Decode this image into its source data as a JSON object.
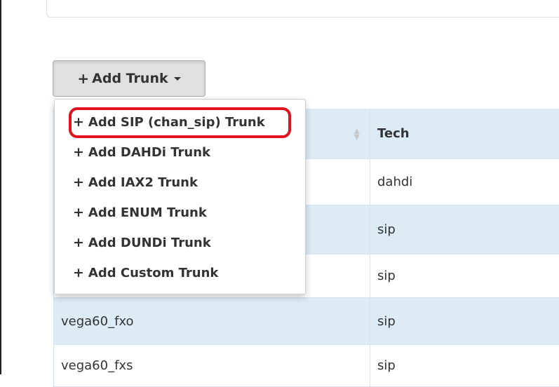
{
  "toolbar": {
    "add_trunk_label": "Add Trunk",
    "plus_glyph": "+"
  },
  "dropdown": {
    "items": [
      {
        "label": "Add SIP (chan_sip) Trunk",
        "highlighted": true
      },
      {
        "label": "Add DAHDi Trunk"
      },
      {
        "label": "Add IAX2 Trunk"
      },
      {
        "label": "Add ENUM Trunk"
      },
      {
        "label": "Add DUNDi Trunk"
      },
      {
        "label": "Add Custom Trunk"
      }
    ],
    "highlight_color": "#e0131f"
  },
  "table": {
    "columns": [
      "",
      "Tech"
    ],
    "rows": [
      {
        "name": "",
        "tech": "dahdi"
      },
      {
        "name": "",
        "tech": "sip"
      },
      {
        "name": "",
        "tech": "sip"
      },
      {
        "name": "vega60_fxo",
        "tech": "sip"
      },
      {
        "name": "vega60_fxs",
        "tech": "sip"
      }
    ],
    "stripe_color": "#ddebf7"
  },
  "icons": {
    "plus": "plus-icon",
    "caret": "caret-down-icon",
    "sort": "sort-icon"
  }
}
